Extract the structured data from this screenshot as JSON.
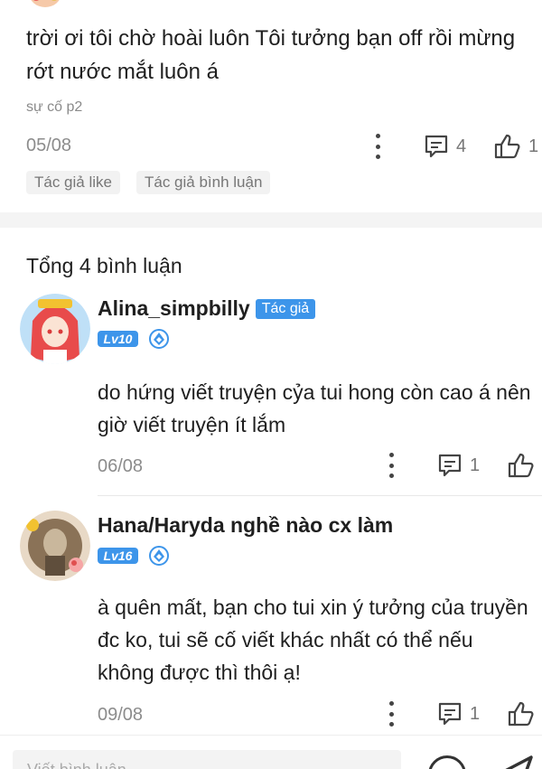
{
  "top_comment": {
    "text": "trời ơi tôi chờ hoài luôn Tôi tưởng bạn off rồi mừng rớt nước mắt luôn á",
    "chapter": "sự cố p2",
    "date": "05/08",
    "comment_count": "4",
    "like_count": "1",
    "tags": [
      "Tác giả like",
      "Tác giả bình luận"
    ]
  },
  "total_label": "Tổng 4 bình luận",
  "comments": [
    {
      "username": "Alina_simpbilly",
      "author_badge": "Tác giả",
      "level": "Lv10",
      "text": "do hứng viết truyện cỷa tui hong còn cao á nên giờ viết truyện ít lắm",
      "date": "06/08",
      "comment_count": "1"
    },
    {
      "username": "Hana/Haryda nghề nào cx làm",
      "level": "Lv16",
      "text": "à quên mất, bạn cho tui xin ý tưởng của truyền đc ko, tui sẽ cố viết khác nhất có thể nếu không được thì thôi ạ!",
      "date": "09/08",
      "comment_count": "1"
    }
  ],
  "input": {
    "placeholder": "Viết bình luận"
  },
  "colors": {
    "accent": "#3d95ea",
    "muted": "#8c8c8c",
    "text": "#1f1f1f"
  },
  "icons": [
    "kebab-menu-icon",
    "comment-icon",
    "thumbs-up-icon",
    "verified-icon",
    "emoji-icon",
    "send-icon"
  ]
}
